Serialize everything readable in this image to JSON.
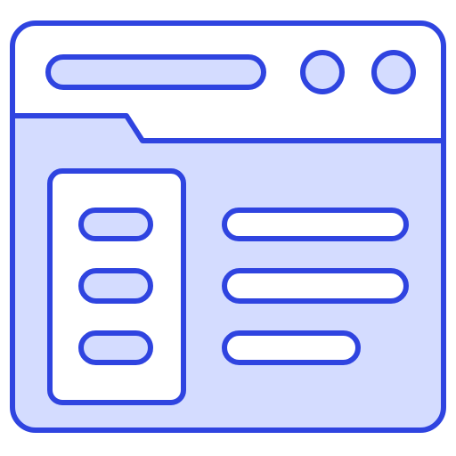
{
  "icon": {
    "name": "browser-window-layout-icon",
    "colors": {
      "stroke": "#2f44e0",
      "fill_light": "#d4dcff",
      "background": "#ffffff"
    }
  }
}
